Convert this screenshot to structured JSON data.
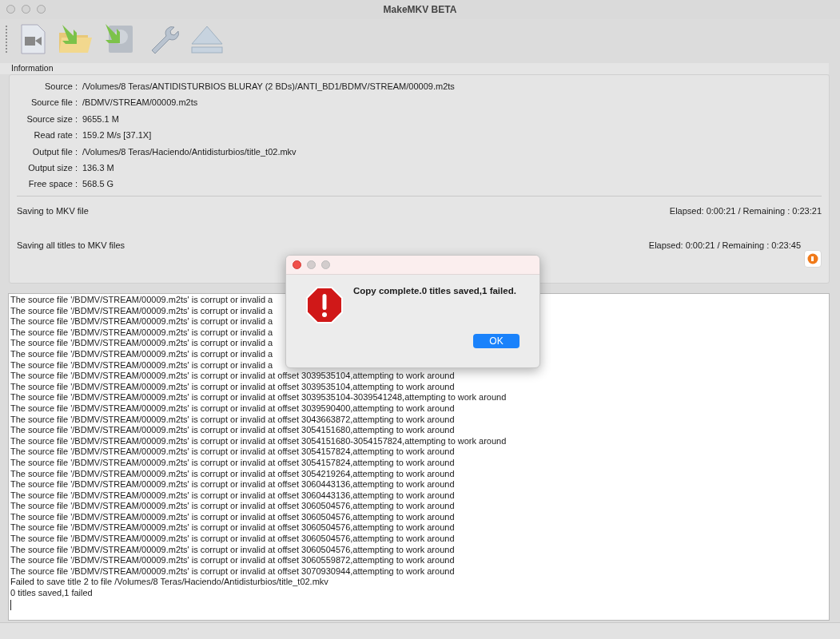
{
  "window": {
    "title": "MakeMKV BETA"
  },
  "information": {
    "title": "Information",
    "fields": [
      {
        "label": "Source :",
        "value": "/Volumes/8 Teras/ANTIDISTURBIOS BLURAY (2 BDs)/ANTI_BD1/BDMV/STREAM/00009.m2ts"
      },
      {
        "label": "Source file :",
        "value": "/BDMV/STREAM/00009.m2ts"
      },
      {
        "label": "Source size :",
        "value": "9655.1 M"
      },
      {
        "label": "Read rate :",
        "value": "159.2 M/s [37.1X]"
      },
      {
        "label": "Output file :",
        "value": "/Volumes/8 Teras/Haciendo/Antidisturbios/title_t02.mkv"
      },
      {
        "label": "Output size :",
        "value": "136.3 M"
      },
      {
        "label": "Free space :",
        "value": "568.5 G"
      }
    ],
    "progress": [
      {
        "label": "Saving to MKV file",
        "time": "Elapsed: 0:00:21 / Remaining : 0:23:21"
      },
      {
        "label": "Saving all titles to MKV files",
        "time": "Elapsed: 0:00:21 / Remaining : 0:23:45"
      }
    ]
  },
  "log": [
    "The source file '/BDMV/STREAM/00009.m2ts' is corrupt or invalid a",
    "The source file '/BDMV/STREAM/00009.m2ts' is corrupt or invalid a",
    "The source file '/BDMV/STREAM/00009.m2ts' is corrupt or invalid a",
    "The source file '/BDMV/STREAM/00009.m2ts' is corrupt or invalid a",
    "The source file '/BDMV/STREAM/00009.m2ts' is corrupt or invalid a",
    "The source file '/BDMV/STREAM/00009.m2ts' is corrupt or invalid a",
    "The source file '/BDMV/STREAM/00009.m2ts' is corrupt or invalid a",
    "The source file '/BDMV/STREAM/00009.m2ts' is corrupt or invalid at offset 3039535104,attempting to work around",
    "The source file '/BDMV/STREAM/00009.m2ts' is corrupt or invalid at offset 3039535104,attempting to work around",
    "The source file '/BDMV/STREAM/00009.m2ts' is corrupt or invalid at offset 3039535104-3039541248,attempting to work around",
    "The source file '/BDMV/STREAM/00009.m2ts' is corrupt or invalid at offset 3039590400,attempting to work around",
    "The source file '/BDMV/STREAM/00009.m2ts' is corrupt or invalid at offset 3043663872,attempting to work around",
    "The source file '/BDMV/STREAM/00009.m2ts' is corrupt or invalid at offset 3054151680,attempting to work around",
    "The source file '/BDMV/STREAM/00009.m2ts' is corrupt or invalid at offset 3054151680-3054157824,attempting to work around",
    "The source file '/BDMV/STREAM/00009.m2ts' is corrupt or invalid at offset 3054157824,attempting to work around",
    "The source file '/BDMV/STREAM/00009.m2ts' is corrupt or invalid at offset 3054157824,attempting to work around",
    "The source file '/BDMV/STREAM/00009.m2ts' is corrupt or invalid at offset 3054219264,attempting to work around",
    "The source file '/BDMV/STREAM/00009.m2ts' is corrupt or invalid at offset 3060443136,attempting to work around",
    "The source file '/BDMV/STREAM/00009.m2ts' is corrupt or invalid at offset 3060443136,attempting to work around",
    "The source file '/BDMV/STREAM/00009.m2ts' is corrupt or invalid at offset 3060504576,attempting to work around",
    "The source file '/BDMV/STREAM/00009.m2ts' is corrupt or invalid at offset 3060504576,attempting to work around",
    "The source file '/BDMV/STREAM/00009.m2ts' is corrupt or invalid at offset 3060504576,attempting to work around",
    "The source file '/BDMV/STREAM/00009.m2ts' is corrupt or invalid at offset 3060504576,attempting to work around",
    "The source file '/BDMV/STREAM/00009.m2ts' is corrupt or invalid at offset 3060504576,attempting to work around",
    "The source file '/BDMV/STREAM/00009.m2ts' is corrupt or invalid at offset 3060559872,attempting to work around",
    "The source file '/BDMV/STREAM/00009.m2ts' is corrupt or invalid at offset 3070930944,attempting to work around",
    "Failed to save title 2 to file /Volumes/8 Teras/Haciendo/Antidisturbios/title_t02.mkv",
    "0 titles saved,1 failed"
  ],
  "dialog": {
    "message": "Copy complete.0 titles saved,1 failed.",
    "button": "OK"
  }
}
